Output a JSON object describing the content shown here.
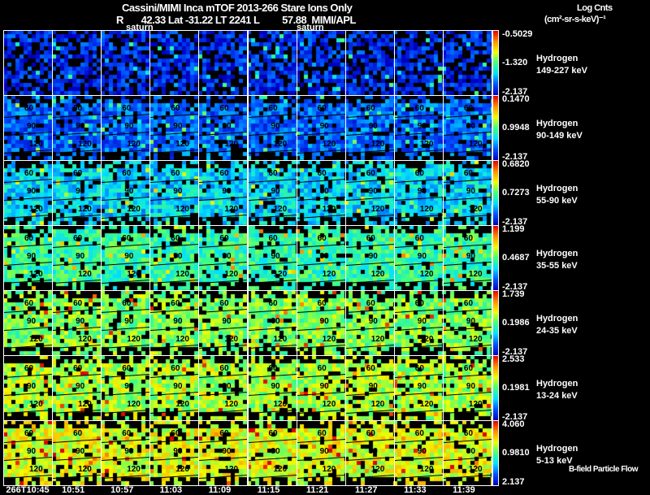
{
  "header": {
    "title": "Cassini/MIMI Inca mTOF  2013-266   Stare   Ions Only",
    "subtitle": "R       42.33 Lat -31.22 LT 2241 L         57.88  MIMI/APL",
    "units_line1": "Log Cnts",
    "units_line2": "(cm²-sr-s-keV)⁻¹"
  },
  "saturn_labels": [
    "saturn",
    "saturn"
  ],
  "contour_labels": [
    "60",
    "90",
    "120"
  ],
  "legend_note": "B-field Particle Flow",
  "chart_data": {
    "type": "heatmap",
    "title": "Cassini/MIMI Inca mTOF  2013-266   Stare   Ions Only",
    "times": [
      "266T10:45",
      "10:51",
      "10:57",
      "11:03",
      "11:09",
      "11:15",
      "11:21",
      "11:27",
      "11:33",
      "11:39"
    ],
    "rows": [
      {
        "species": "Hydrogen",
        "energy": "149-227 keV",
        "max": "-0.5029",
        "mid": "-1.320",
        "min": "-2.137",
        "level": 0.1
      },
      {
        "species": "Hydrogen",
        "energy": "90-149 keV",
        "max": "0.1470",
        "mid": "0.9948",
        "min": "-2.137",
        "level": 0.18
      },
      {
        "species": "Hydrogen",
        "energy": "55-90 keV",
        "max": "0.6820",
        "mid": "0.7273",
        "min": "-2.137",
        "level": 0.33
      },
      {
        "species": "Hydrogen",
        "energy": "35-55 keV",
        "max": "1.199",
        "mid": "0.4687",
        "min": "-2.137",
        "level": 0.45
      },
      {
        "species": "Hydrogen",
        "energy": "24-35 keV",
        "max": "1.739",
        "mid": "0.1986",
        "min": "-2.137",
        "level": 0.55
      },
      {
        "species": "Hydrogen",
        "energy": "13-24 keV",
        "max": "2.533",
        "mid": "0.1981",
        "min": "-2.137",
        "level": 0.6
      },
      {
        "species": "Hydrogen",
        "energy": "5-13 keV",
        "max": "4.060",
        "mid": "0.9810",
        "min": "2.137",
        "level": 0.66
      }
    ],
    "colorscale": [
      "#0000c0",
      "#0050ff",
      "#00e0ff",
      "#40ff80",
      "#f0ff00",
      "#ff9000",
      "#e00000"
    ]
  }
}
